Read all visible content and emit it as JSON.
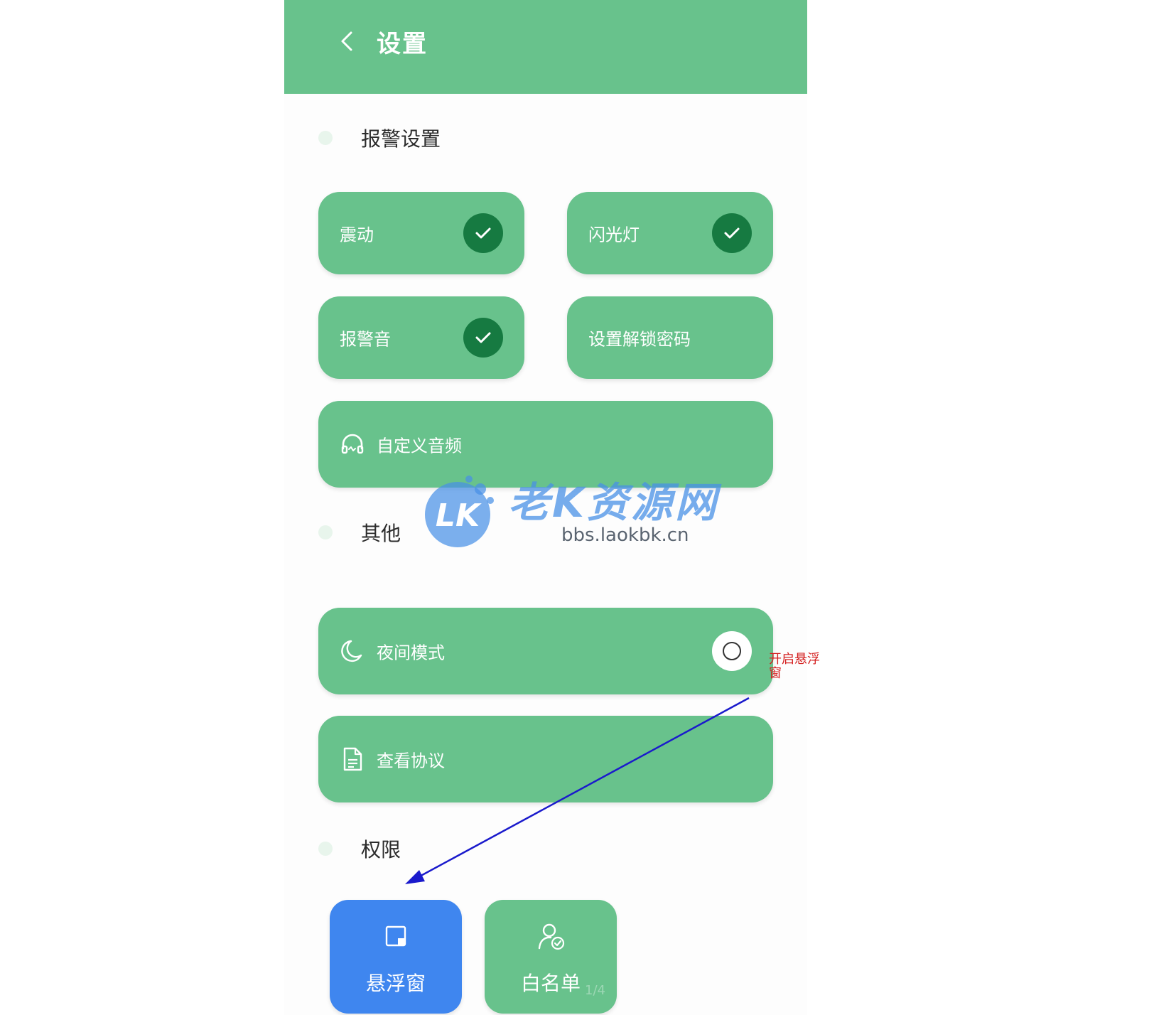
{
  "header": {
    "title": "设置",
    "back_icon": "chevron-left-icon"
  },
  "sections": {
    "alarm": "报警设置",
    "other": "其他",
    "permissions": "权限"
  },
  "alarm_tiles": [
    {
      "label": "震动",
      "checked": true
    },
    {
      "label": "闪光灯",
      "checked": true
    },
    {
      "label": "报警音",
      "checked": true
    },
    {
      "label": "设置解锁密码",
      "checked": false
    }
  ],
  "custom_audio": {
    "label": "自定义音频",
    "icon": "headphones-icon"
  },
  "night_mode": {
    "label": "夜间模式",
    "icon": "moon-icon",
    "enabled": false
  },
  "agreement": {
    "label": "查看协议",
    "icon": "document-icon"
  },
  "permission_tiles": [
    {
      "label": "悬浮窗",
      "icon": "floating-window-icon",
      "color": "#3f86ef"
    },
    {
      "label": "白名单",
      "icon": "user-check-icon",
      "color": "#68c28c"
    }
  ],
  "page_indicator": "1/4",
  "watermark": {
    "title": "老K资源网",
    "url": "bbs.laokbk.cn",
    "logo_text": "LK"
  },
  "annotation": {
    "text": "开启悬浮窗"
  },
  "colors": {
    "primary_green": "#68c28c",
    "dark_green": "#167a41",
    "blue": "#3f86ef",
    "annotation_red": "#d42020",
    "annotation_arrow": "#1a1acc"
  }
}
